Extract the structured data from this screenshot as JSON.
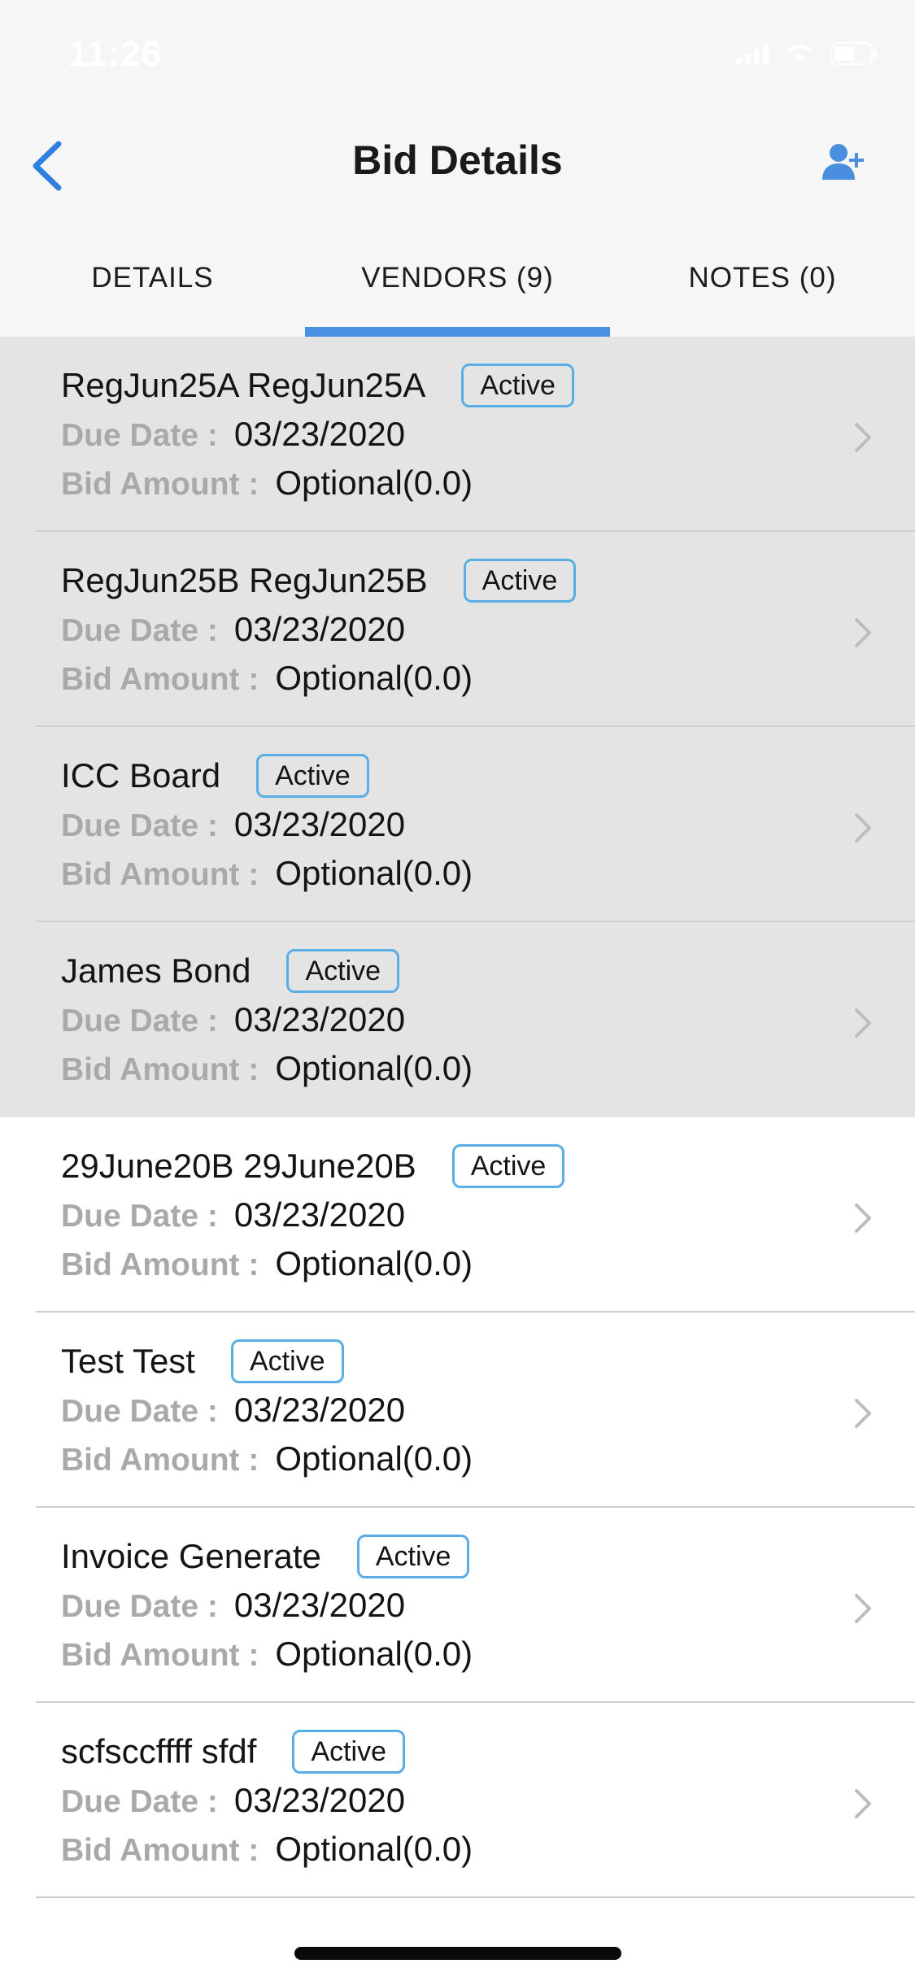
{
  "status_bar": {
    "time": "11:26"
  },
  "nav": {
    "title": "Bid Details",
    "back_icon": "chevron-left-icon",
    "add_icon": "add-user-icon"
  },
  "tabs": [
    {
      "label": "DETAILS",
      "active": false
    },
    {
      "label": "VENDORS (9)",
      "active": true
    },
    {
      "label": "NOTES (0)",
      "active": false
    }
  ],
  "labels": {
    "due_date": "Due Date :",
    "bid_amount": "Bid Amount :"
  },
  "vendors": [
    {
      "name": "RegJun25A RegJun25A",
      "status": "Active",
      "due_date": "03/23/2020",
      "bid_amount": "Optional(0.0)"
    },
    {
      "name": "RegJun25B RegJun25B",
      "status": "Active",
      "due_date": "03/23/2020",
      "bid_amount": "Optional(0.0)"
    },
    {
      "name": "ICC Board",
      "status": "Active",
      "due_date": "03/23/2020",
      "bid_amount": "Optional(0.0)"
    },
    {
      "name": "James Bond",
      "status": "Active",
      "due_date": "03/23/2020",
      "bid_amount": "Optional(0.0)"
    },
    {
      "name": "29June20B 29June20B",
      "status": "Active",
      "due_date": "03/23/2020",
      "bid_amount": "Optional(0.0)"
    },
    {
      "name": "Test Test",
      "status": "Active",
      "due_date": "03/23/2020",
      "bid_amount": "Optional(0.0)"
    },
    {
      "name": "Invoice Generate",
      "status": "Active",
      "due_date": "03/23/2020",
      "bid_amount": "Optional(0.0)"
    },
    {
      "name": "scfsccffff sfdf",
      "status": "Active",
      "due_date": "03/23/2020",
      "bid_amount": "Optional(0.0)"
    }
  ],
  "colors": {
    "accent": "#4a90e2",
    "badge_border": "#5aaee6",
    "label_gray": "#a9a9a9",
    "row_shaded": "#e4e4e4",
    "header_bg": "#f6f6f6"
  }
}
